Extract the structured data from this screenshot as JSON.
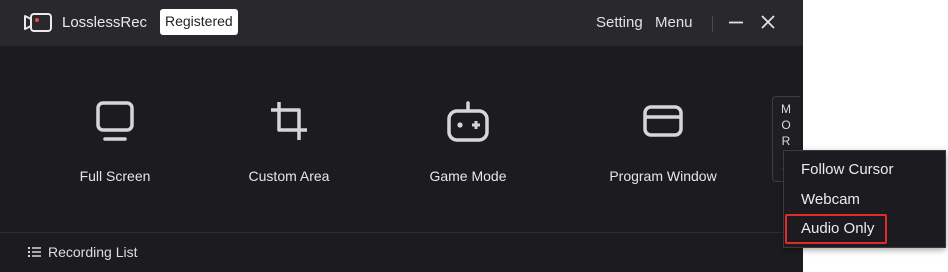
{
  "titlebar": {
    "app_name": "LosslessRec",
    "badge": "Registered",
    "setting_label": "Setting",
    "menu_label": "Menu",
    "icons": [
      "app-logo-icon",
      "minimize-icon",
      "close-icon"
    ]
  },
  "modes": [
    {
      "label": "Full Screen",
      "icon": "monitor-icon"
    },
    {
      "label": "Custom Area",
      "icon": "crop-icon"
    },
    {
      "label": "Game Mode",
      "icon": "gamepad-icon"
    },
    {
      "label": "Program Window",
      "icon": "window-icon"
    }
  ],
  "more": {
    "letters": [
      "M",
      "O",
      "R",
      "E"
    ],
    "chevron": "chevron-down-icon"
  },
  "footer": {
    "recording_list_label": "Recording List",
    "icon": "list-icon"
  },
  "dropdown": {
    "items": [
      "Follow Cursor",
      "Webcam",
      "Audio Only"
    ],
    "highlighted": "Audio Only"
  },
  "colors": {
    "window_bg": "#1c1c20",
    "titlebar_bg": "#29292d",
    "highlight_border": "#e02b2b",
    "accent_logo": "#e84c3d"
  }
}
